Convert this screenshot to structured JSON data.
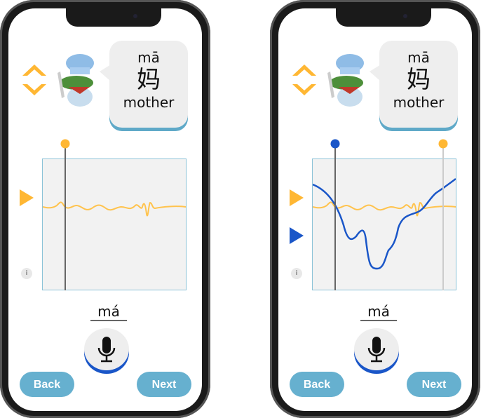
{
  "card": {
    "pinyin": "mā",
    "hanzi": "妈",
    "english": "mother"
  },
  "answer": {
    "syllable": "má"
  },
  "info_label": "i",
  "buttons": {
    "back": "Back",
    "next": "Next"
  },
  "colors": {
    "reference": "#ffb733",
    "user": "#1a56c8",
    "accent": "#66b0cf"
  }
}
